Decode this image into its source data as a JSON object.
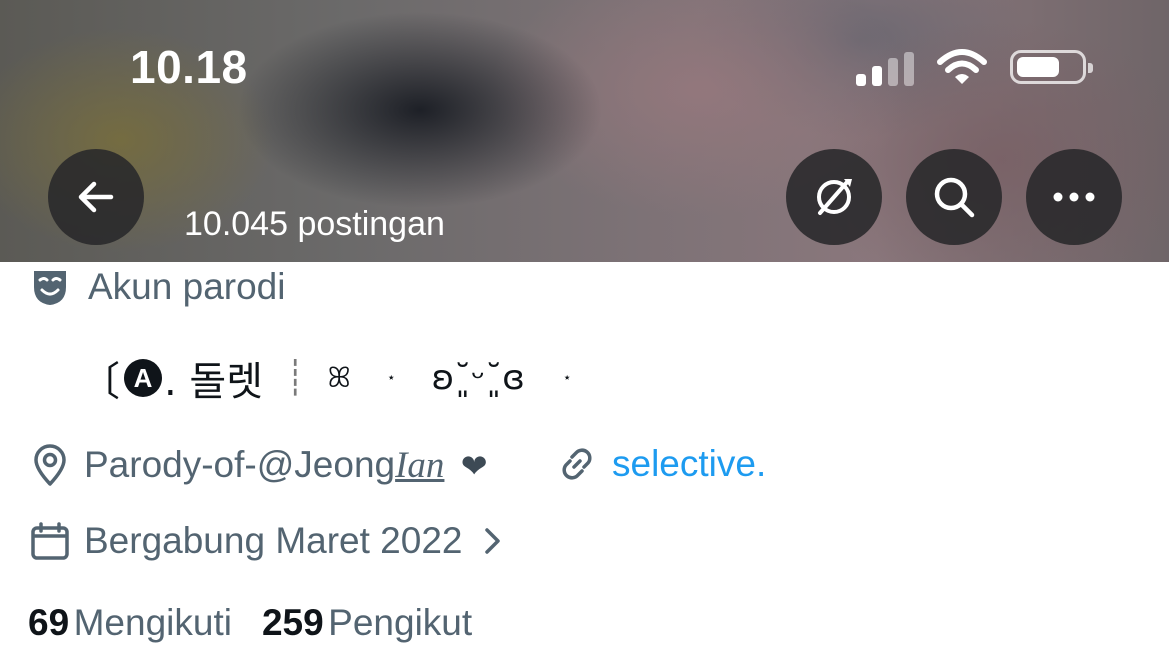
{
  "status_bar": {
    "time": "10.18"
  },
  "header": {
    "post_count": "10.045 postingan"
  },
  "profile": {
    "parody_label": "Akun parodi",
    "bio_prefix": "〔",
    "bio_badge": "A",
    "bio_name": ". 돌렛",
    "bio_divider": "┊",
    "bio_decor_1": "ꕤ",
    "bio_star_1": "⋆",
    "bio_decor_2": "ʚ˘͈ᵕ˘͈ɞ",
    "bio_star_2": "⋆",
    "location_prefix": "Parody-of-@Jeong",
    "location_styled": "Ian",
    "location_heart": "❤",
    "website": "selective.",
    "joined": "Bergabung Maret 2022",
    "following_count": "69",
    "following_label": "Mengikuti",
    "followers_count": "259",
    "followers_label": "Pengikut"
  },
  "colors": {
    "link": "#1d9bf0",
    "secondary_text": "#536471",
    "primary_text": "#0f1419"
  },
  "icons": [
    "back-arrow-icon",
    "explore-slash-icon",
    "search-icon",
    "more-icon",
    "parody-mask-icon",
    "location-pin-icon",
    "link-icon",
    "calendar-icon",
    "chevron-right-icon"
  ]
}
